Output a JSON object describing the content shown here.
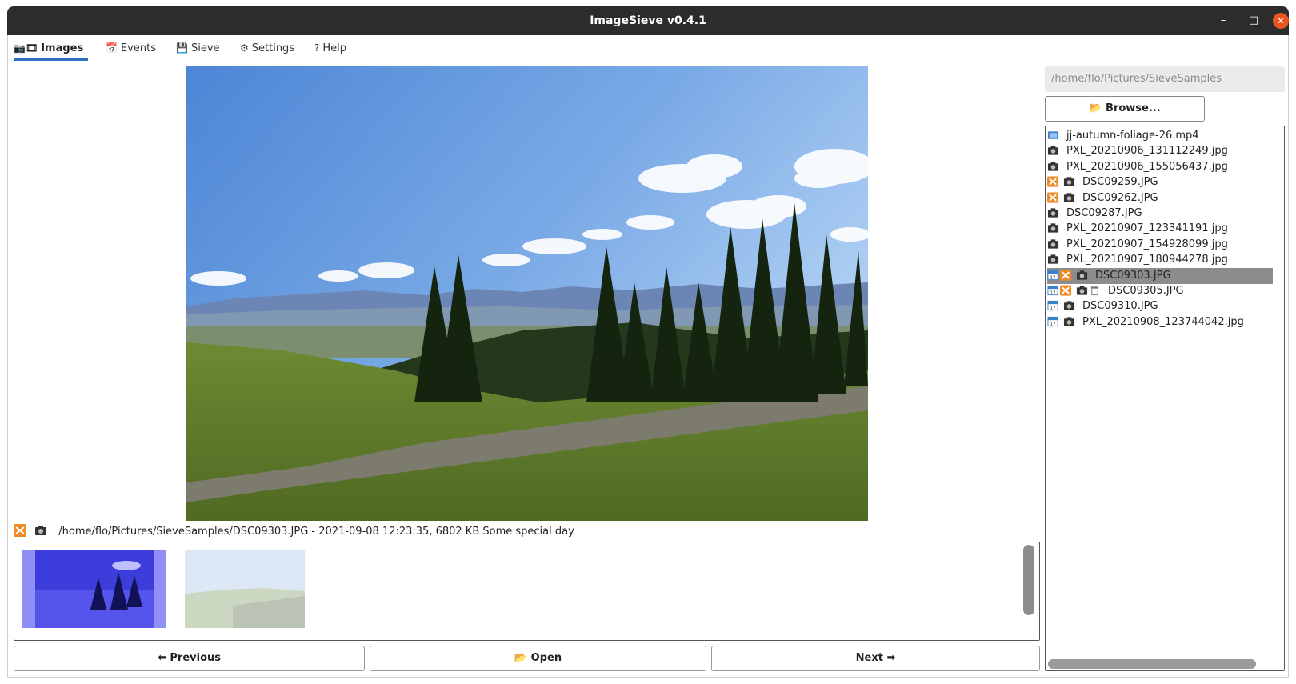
{
  "window": {
    "title": "ImageSieve v0.4.1",
    "minimize": "–",
    "maximize": "□",
    "close": "✕"
  },
  "tabs": [
    {
      "label": "Images",
      "icon": "camera-film-icon",
      "active": true
    },
    {
      "label": "Events",
      "icon": "calendar-icon",
      "active": false
    },
    {
      "label": "Sieve",
      "icon": "floppy-disk-icon",
      "active": false
    },
    {
      "label": "Settings",
      "icon": "gear-icon",
      "glyph": "⚙",
      "active": false
    },
    {
      "label": "Help",
      "icon": "question-icon",
      "glyph": "?",
      "active": false
    }
  ],
  "info": {
    "path": "/home/flo/Pictures/SieveSamples/DSC09303.JPG - 2021-09-08 12:23:35, 6802 KB Some special day"
  },
  "nav": {
    "previous": "⬅ Previous",
    "open": "Open",
    "next": "Next ➡"
  },
  "sidebar": {
    "path": "/home/flo/Pictures/SieveSamples",
    "browse": "Browse..."
  },
  "files": [
    {
      "name": "jj-autumn-foliage-26.mp4",
      "icons": [
        "film-icon"
      ],
      "selected": false
    },
    {
      "name": "PXL_20210906_131112249.jpg",
      "icons": [
        "camera-icon"
      ],
      "selected": false
    },
    {
      "name": "PXL_20210906_155056437.jpg",
      "icons": [
        "camera-icon"
      ],
      "selected": false
    },
    {
      "name": "DSC09259.JPG",
      "icons": [
        "shuffle-icon",
        "camera-icon"
      ],
      "selected": false
    },
    {
      "name": "DSC09262.JPG",
      "icons": [
        "shuffle-icon",
        "camera-icon"
      ],
      "selected": false
    },
    {
      "name": "DSC09287.JPG",
      "icons": [
        "camera-icon"
      ],
      "selected": false
    },
    {
      "name": "PXL_20210907_123341191.jpg",
      "icons": [
        "camera-icon"
      ],
      "selected": false
    },
    {
      "name": "PXL_20210907_154928099.jpg",
      "icons": [
        "camera-icon"
      ],
      "selected": false
    },
    {
      "name": "PXL_20210907_180944278.jpg",
      "icons": [
        "camera-icon"
      ],
      "selected": false
    },
    {
      "name": "DSC09303.JPG",
      "icons": [
        "calendar-icon",
        "shuffle-icon",
        "camera-icon"
      ],
      "selected": true
    },
    {
      "name": "DSC09305.JPG",
      "icons": [
        "calendar-icon",
        "shuffle-icon",
        "camera-icon",
        "trash-icon"
      ],
      "selected": false
    },
    {
      "name": "DSC09310.JPG",
      "icons": [
        "calendar-icon",
        "camera-icon"
      ],
      "selected": false
    },
    {
      "name": "PXL_20210908_123744042.jpg",
      "icons": [
        "calendar-icon",
        "camera-icon"
      ],
      "selected": false
    }
  ],
  "colors": {
    "selection": "#8c8c8c",
    "accent": "#2f6fbf",
    "shuffle": "#f08a24",
    "titlebar": "#2c2c2c",
    "close": "#e95420"
  }
}
